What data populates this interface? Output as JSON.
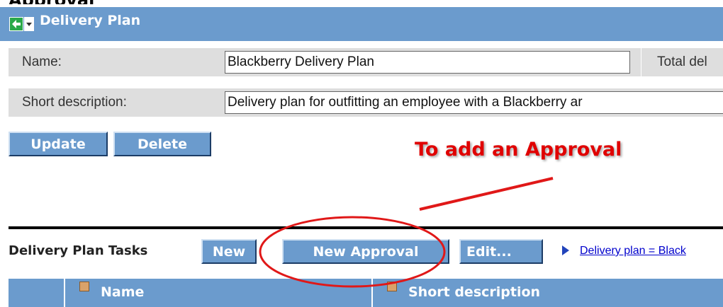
{
  "header": {
    "title": "Delivery Plan"
  },
  "form": {
    "name_label": "Name:",
    "name_value": "Blackberry Delivery Plan",
    "total_label": "Total del",
    "short_desc_label": "Short description:",
    "short_desc_value": "Delivery plan for outfitting an employee with a Blackberry ar"
  },
  "actions": {
    "update_label": "Update",
    "delete_label": "Delete"
  },
  "annotation": {
    "text": "To add an Approval",
    "color": "#e00000"
  },
  "tasks": {
    "section_label": "Delivery Plan Tasks",
    "new_label": "New",
    "new_approval_label": "New Approval",
    "edit_label": "Edit...",
    "filter_link": "Delivery plan = Black"
  },
  "table": {
    "columns": [
      "Name",
      "Short description"
    ]
  },
  "colors": {
    "header_blue": "#6b9bcd",
    "row_gray": "#dedede",
    "link_blue": "#0000cc"
  }
}
